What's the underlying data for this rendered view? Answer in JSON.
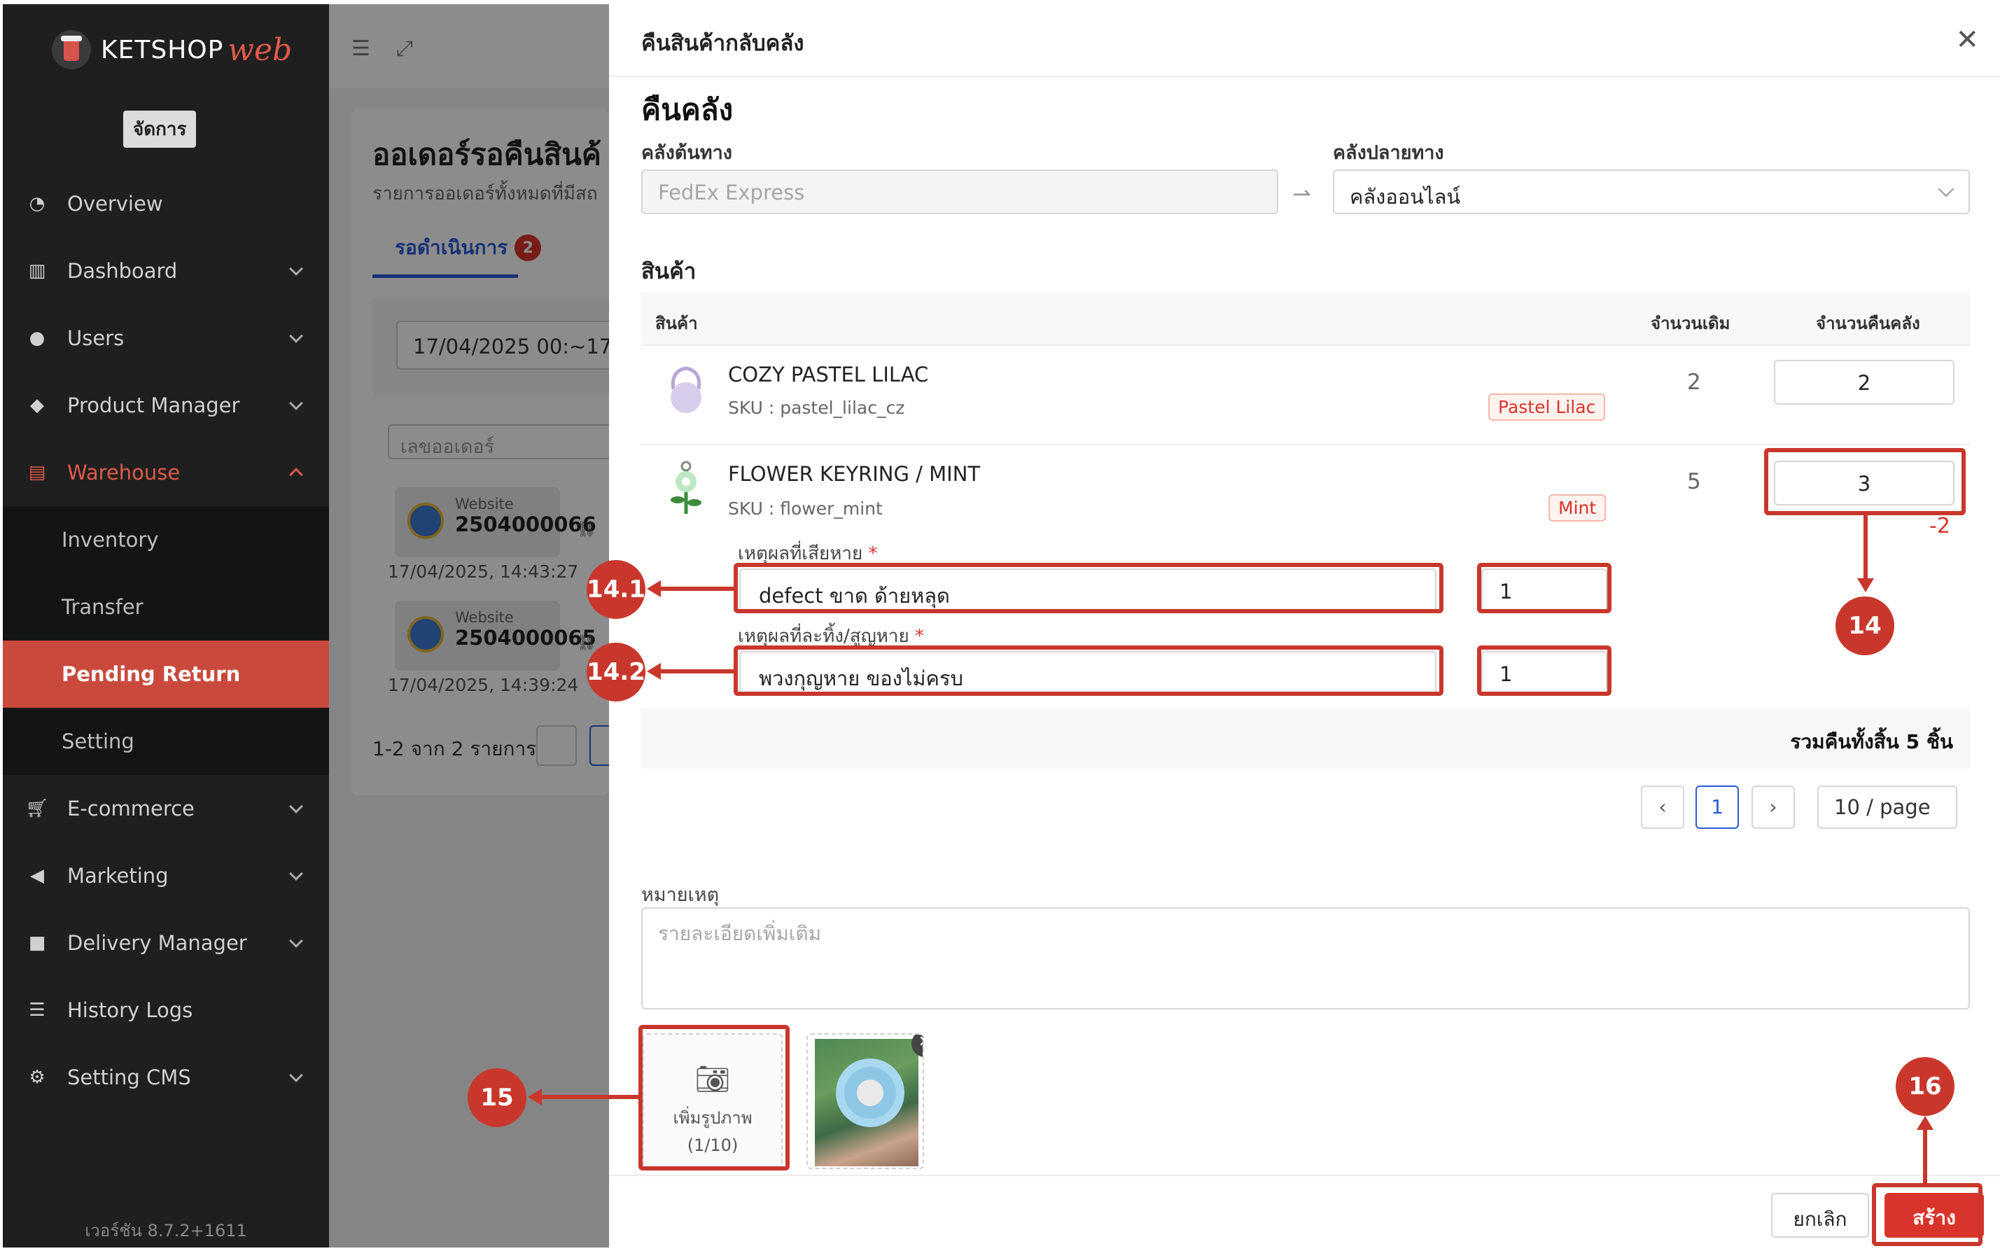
{
  "app": {
    "brand": "KETSHOP",
    "brand_suffix": "web",
    "role": "จัดการ",
    "version": "เวอร์ชัน 8.7.2+1611"
  },
  "sidebar": {
    "items": [
      {
        "label": "Overview",
        "icon": "pie-chart-icon"
      },
      {
        "label": "Dashboard",
        "icon": "bar-chart-icon"
      },
      {
        "label": "Users",
        "icon": "users-icon"
      },
      {
        "label": "Product Manager",
        "icon": "tag-icon"
      },
      {
        "label": "Warehouse",
        "icon": "warehouse-icon"
      },
      {
        "label": "E-commerce",
        "icon": "cart-icon"
      },
      {
        "label": "Marketing",
        "icon": "megaphone-icon"
      },
      {
        "label": "Delivery Manager",
        "icon": "truck-icon"
      },
      {
        "label": "History Logs",
        "icon": "list-icon"
      },
      {
        "label": "Setting CMS",
        "icon": "gear-icon"
      }
    ],
    "warehouse_sub": [
      "Inventory",
      "Transfer",
      "Pending Return",
      "Setting"
    ]
  },
  "background": {
    "title": "ออเดอร์รอคืนสินค้",
    "subtitle": "รายการออเดอร์ทั้งหมดที่มีสถ",
    "tab_label": "รอดำเนินการ",
    "tab_count": "2",
    "date_range": "17/04/2025 00:~17/0",
    "search_placeholder": "เลขออเดอร์",
    "orders": [
      {
        "source": "Website",
        "number": "2504000066",
        "time": "17/04/2025, 14:43:27"
      },
      {
        "source": "Website",
        "number": "2504000065",
        "time": "17/04/2025, 14:39:24"
      }
    ],
    "pager_text": "1-2 จาก 2 รายการ"
  },
  "drawer": {
    "title": "คืนสินค้ากลับคลัง",
    "section_title": "คืนคลัง",
    "source_label": "คลังต้นทาง",
    "source_value": "FedEx Express",
    "dest_label": "คลังปลายทาง",
    "dest_value": "คลังออนไลน์",
    "products_title": "สินค้า",
    "col_product": "สินค้า",
    "col_orig_qty": "จำนวนเดิม",
    "col_return_qty": "จำนวนคืนคลัง",
    "products": [
      {
        "name": "COZY PASTEL LILAC",
        "sku": "SKU : pastel_lilac_cz",
        "variant": "Pastel Lilac",
        "orig_qty": "2",
        "return_qty": "2"
      },
      {
        "name": "FLOWER KEYRING / MINT",
        "sku": "SKU : flower_mint",
        "variant": "Mint",
        "orig_qty": "5",
        "return_qty": "3"
      }
    ],
    "damage_label": "เหตุผลที่เสียหาย",
    "damage_reason": "defect ขาด ด้ายหลุด",
    "damage_qty": "1",
    "lost_label": "เหตุผลที่ละทิ้ง/สูญหาย",
    "lost_reason": "พวงกุญหาย ของไม่ครบ",
    "lost_qty": "1",
    "required_mark": "*",
    "total": "รวมคืนทั้งสิ้น 5 ชิ้น",
    "page": "1",
    "page_size": "10 / page",
    "note_label": "หมายเหตุ",
    "note_placeholder": "รายละเอียดเพิ่มเติม",
    "upload_label": "เพิ่มรูปภาพ",
    "upload_count": "(1/10)",
    "cancel": "ยกเลิก",
    "create": "สร้าง"
  },
  "annotations": {
    "step14": "14",
    "step14_1": "14.1",
    "step14_2": "14.2",
    "step15": "15",
    "step16": "16",
    "diff": "-2"
  },
  "colors": {
    "accent": "#c9372c",
    "primary_blue": "#2a5bd7",
    "sidebar_bg": "#1f1f1f"
  }
}
